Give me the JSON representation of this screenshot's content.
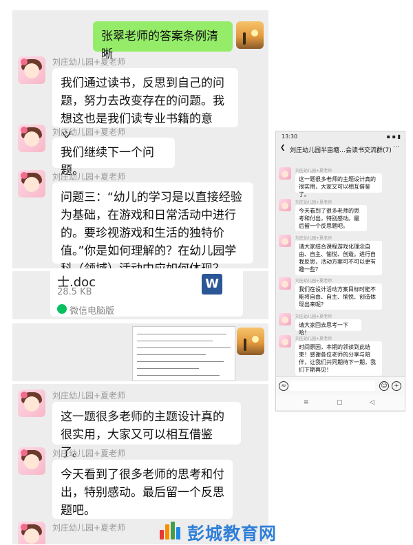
{
  "top_chat": {
    "my_message": "张翠老师的答案条例清晰",
    "messages": [
      {
        "sender": "刘庄幼儿园+夏老师",
        "text": "我们通过读书，反思到自己的问题，努力去改变存在的问题。我想这也是我们读专业书籍的意义。"
      },
      {
        "sender": "刘庄幼儿园+夏老师",
        "text": "我们继续下一个问题。"
      },
      {
        "sender": "刘庄幼儿园+夏老师",
        "text": "问题三：“幼儿的学习是以直接经验为基础，在游戏和日常活动中进行的。要珍视游戏和生活的独特价值。”你是如何理解的？在幼儿园学科（领域）活动中应如何体现？"
      }
    ]
  },
  "file_card": {
    "name": "士.doc",
    "size": "28.5 KB",
    "source": "微信电脑版",
    "icon": "W"
  },
  "bottom_chat": {
    "messages": [
      {
        "sender": "刘庄幼儿园+夏老师",
        "text": "这一题很多老师的主题设计真的很实用，大家又可以相互借鉴了。"
      },
      {
        "sender": "刘庄幼儿园+夏老师",
        "text": "今天看到了很多老师的思考和付出，特别感动。最后留一个反思题吧。"
      },
      {
        "sender": "刘庄幼儿园+夏老师",
        "text": ""
      }
    ]
  },
  "phone": {
    "time": "13:30",
    "status_right": "▪ ▪ ▮",
    "title": "刘庄幼儿园半亩塘…会读书交流群(7)",
    "messages": [
      {
        "sender": "刘庄幼儿园+夏老师",
        "text": "这一题很多老师的主题设计真的很实用，大家又可以相互借鉴了。"
      },
      {
        "sender": "刘庄幼儿园+夏老师",
        "text": "今天看到了很多老师的思考和付出，特别感动。最后留一个反思题吧。"
      },
      {
        "sender": "刘庄幼儿园+夏老师",
        "text": "请大家结合课程游戏化理念自由、自主、愉悦、创造。进行自我反思，活动方案可不可以更有趣一些？"
      },
      {
        "sender": "刘庄幼儿园+夏老师",
        "text": "我们在设计活动方案目标时能不能将自由、自主、愉悦、创造体现出来呢？"
      },
      {
        "sender": "刘庄幼儿园+夏老师",
        "text": "请大家回去思考一下哈！"
      },
      {
        "sender": "刘庄幼儿园+夏老师",
        "text": "时间原因，本期的领读到此结束！感谢各位老师的分享与陪伴，让我们共同期待下一期，我们下期再见！"
      }
    ]
  },
  "watermark": "彭城教育网"
}
